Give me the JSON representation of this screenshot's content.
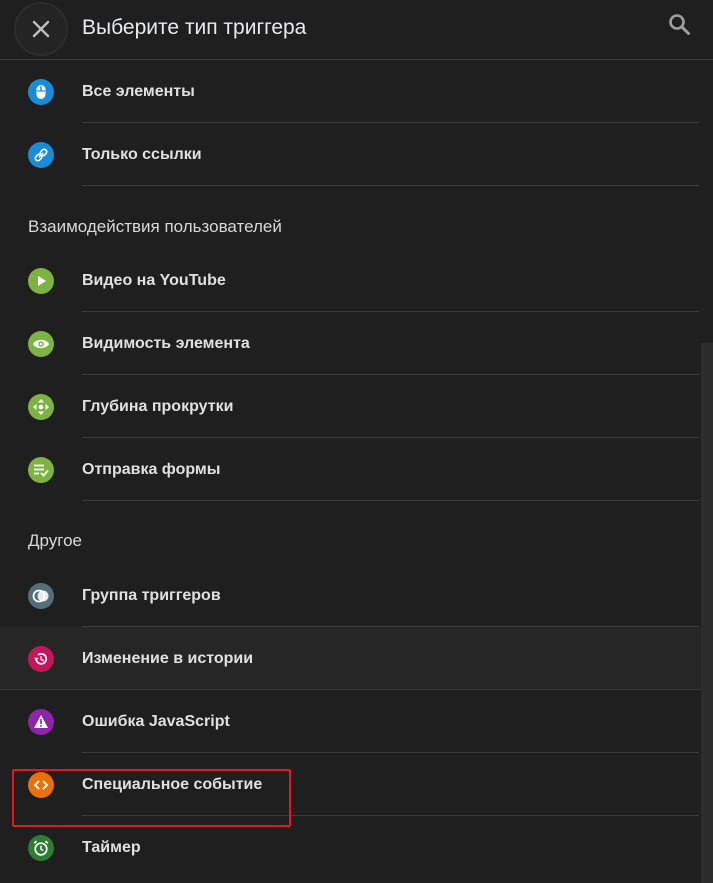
{
  "header": {
    "title": "Выберите тип триггера",
    "close_icon": "close-icon",
    "search_icon": "search-icon"
  },
  "colors": {
    "background": "#1f1f1f",
    "blue": "#1a8bd6",
    "green": "#7cb342",
    "gray": "#546e7a",
    "crimson": "#c2185b",
    "purple": "#8e24aa",
    "orange": "#e8710a",
    "dark_green": "#2e7d32",
    "highlight_border": "#e8141e"
  },
  "groups": [
    {
      "items": [
        {
          "label": "Все элементы",
          "icon": "mouse-icon"
        },
        {
          "label": "Только ссылки",
          "icon": "link-icon"
        }
      ]
    },
    {
      "title": "Взаимодействия пользователей",
      "items": [
        {
          "label": "Видео на YouTube",
          "icon": "play-icon"
        },
        {
          "label": "Видимость элемента",
          "icon": "eye-icon"
        },
        {
          "label": "Глубина прокрутки",
          "icon": "scroll-arrows-icon"
        },
        {
          "label": "Отправка формы",
          "icon": "form-check-icon"
        }
      ]
    },
    {
      "title": "Другое",
      "items": [
        {
          "label": "Группа триггеров",
          "icon": "trigger-group-icon"
        },
        {
          "label": "Изменение в истории",
          "icon": "history-icon"
        },
        {
          "label": "Ошибка JavaScript",
          "icon": "warning-icon"
        },
        {
          "label": "Специальное событие",
          "icon": "code-icon"
        },
        {
          "label": "Таймер",
          "icon": "timer-icon"
        }
      ]
    }
  ]
}
